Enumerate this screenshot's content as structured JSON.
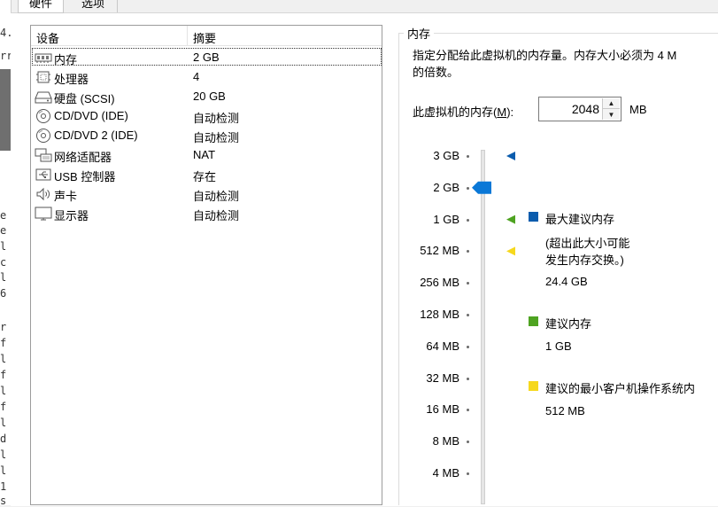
{
  "tabs": {
    "hardware": "硬件",
    "options": "选项"
  },
  "left_strip": {
    "top_chars": [
      "4.",
      "rr"
    ],
    "mid_chars": [
      "e",
      "e",
      "l",
      "c",
      "l",
      "6"
    ],
    "low_chars": [
      "r",
      "f",
      "l",
      "f",
      "l",
      "f",
      "l",
      "d",
      "l",
      "l",
      "1",
      "s"
    ]
  },
  "device_list": {
    "header": {
      "device": "设备",
      "summary": "摘要"
    },
    "rows": [
      {
        "icon": "memory-icon",
        "name": "内存",
        "summary": "2 GB"
      },
      {
        "icon": "cpu-icon",
        "name": "处理器",
        "summary": "4"
      },
      {
        "icon": "hard-disk-icon",
        "name": "硬盘 (SCSI)",
        "summary": "20 GB"
      },
      {
        "icon": "cd-dvd-icon",
        "name": "CD/DVD (IDE)",
        "summary": "自动检测"
      },
      {
        "icon": "cd-dvd-icon",
        "name": "CD/DVD 2 (IDE)",
        "summary": "自动检测"
      },
      {
        "icon": "network-adapter-icon",
        "name": "网络适配器",
        "summary": "NAT"
      },
      {
        "icon": "usb-icon",
        "name": "USB 控制器",
        "summary": "存在"
      },
      {
        "icon": "speaker-icon",
        "name": "声卡",
        "summary": "自动检测"
      },
      {
        "icon": "monitor-icon",
        "name": "显示器",
        "summary": "自动检测"
      }
    ]
  },
  "memory": {
    "group_title": "内存",
    "description": [
      "指定分配给此虚拟机的内存量。内存大小必须为 4 M",
      "的倍数。"
    ],
    "label_prefix": "此虚拟机的内存(",
    "label_mnemonic": "M",
    "label_suffix": "):",
    "value": "2048",
    "unit": "MB",
    "scale_labels": [
      "3 GB",
      "2 GB",
      "1 GB",
      "512 MB",
      "256 MB",
      "128 MB",
      "64 MB",
      "32 MB",
      "16 MB",
      "8 MB",
      "4 MB"
    ],
    "current_marker_value": "2 GB",
    "markers": [
      {
        "color": "#0b5cad",
        "at": "3 GB"
      },
      {
        "color": "#4ea321",
        "at": "1 GB"
      },
      {
        "color": "#f6d81d",
        "at": "512 MB"
      }
    ],
    "legend": {
      "max_recommended": {
        "color": "#0b5cad",
        "label": "最大建议内存",
        "note_line1": "(超出此大小可能",
        "note_line2": "发生内存交换。)",
        "value": "24.4 GB"
      },
      "recommended": {
        "color": "#4ea321",
        "label": "建议内存",
        "value": "1 GB"
      },
      "min_guest": {
        "color": "#f6d81d",
        "label": "建议的最小客户机操作系统内",
        "value": "512 MB"
      }
    }
  }
}
